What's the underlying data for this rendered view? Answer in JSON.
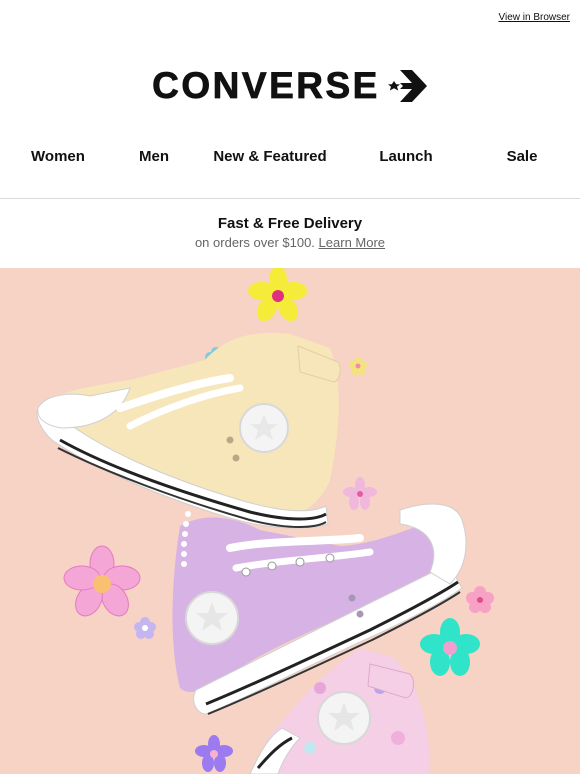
{
  "header": {
    "view_in_browser": "View in Browser",
    "brand": "CONVERSE"
  },
  "nav": {
    "items": [
      {
        "label": "Women"
      },
      {
        "label": "Men"
      },
      {
        "label": "New & Featured"
      },
      {
        "label": "Launch"
      },
      {
        "label": "Sale"
      }
    ]
  },
  "promo": {
    "title": "Fast & Free Delivery",
    "subtitle": "on orders over $100.",
    "link": "Learn More"
  },
  "hero": {
    "background_color": "#f6d3c4",
    "subject": "sneakers-image"
  },
  "colors": {
    "text": "#111111",
    "muted": "#666666",
    "divider": "#d9d9d9"
  }
}
